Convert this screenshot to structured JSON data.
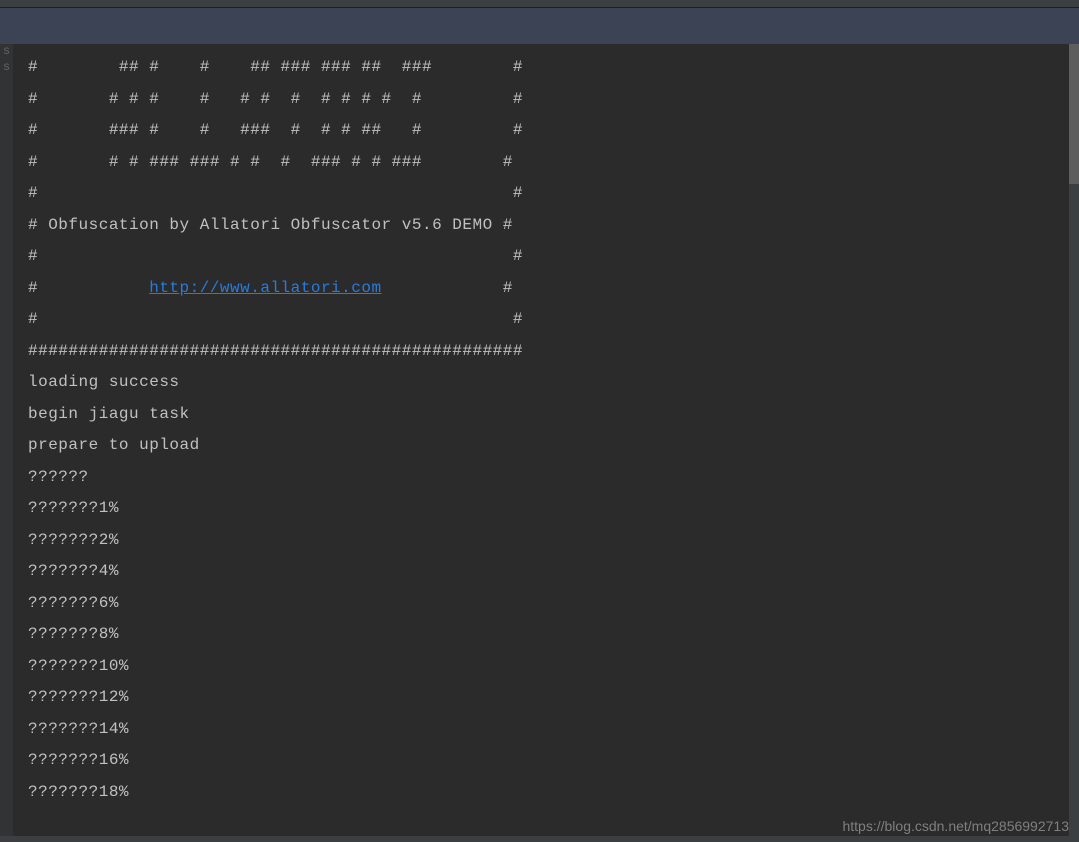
{
  "console": {
    "banner": [
      "#        ## #    #    ## ### ### ##  ###        #",
      "#       # # #    #   # #  #  # # # #  #         #",
      "#       ### #    #   ###  #  # # ##   #         #",
      "#       # # ### ### # #  #  ### # # ###        #",
      "#                                               #",
      "# Obfuscation by Allatori Obfuscator v5.6 DEMO #",
      "#                                               #"
    ],
    "link_prefix": "#           ",
    "link_url": "http://www.allatori.com",
    "link_suffix": "            #",
    "link_postline": "#                                               #",
    "footer_hash": "#################################################",
    "messages": [
      "",
      "loading success",
      "begin jiagu task",
      "prepare to upload",
      "??????",
      "???????1%",
      "???????2%",
      "???????4%",
      "???????6%",
      "???????8%",
      "???????10%",
      "???????12%",
      "???????14%",
      "???????16%",
      "???????18%"
    ]
  },
  "gutter": {
    "char": "s"
  },
  "watermark": "https://blog.csdn.net/mq2856992713"
}
